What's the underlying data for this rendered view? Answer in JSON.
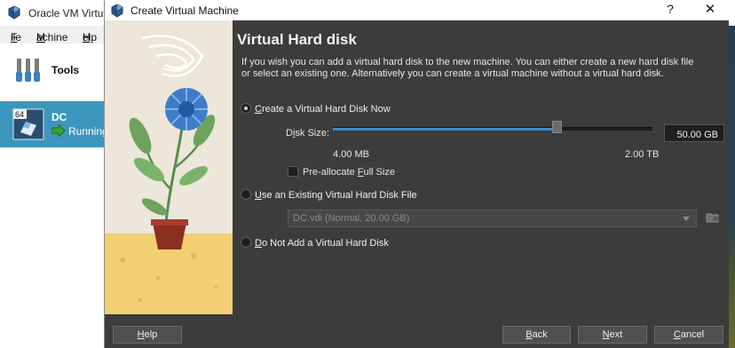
{
  "background_window": {
    "title": "Oracle VM Virtu",
    "menu": [
      {
        "label": "File",
        "accel": "F",
        "rest": "ile"
      },
      {
        "label": "Machine",
        "accel": "M",
        "rest": "achine"
      },
      {
        "label": "Help",
        "accel": "H",
        "rest": "elp"
      }
    ],
    "tools_label": "Tools",
    "vm": {
      "badge": "64",
      "name": "DC",
      "state": "Running"
    },
    "colors": {
      "selected_row": "#3d96bd",
      "running_arrow": "#3aa53a"
    }
  },
  "dialog": {
    "title": "Create Virtual Machine",
    "help_icon": "question-mark",
    "close_icon": "close-x",
    "heading": "Virtual Hard disk",
    "description": "If you wish you can add a virtual hard disk to the new machine. You can either create a new hard disk file or select an existing one. Alternatively you can create a virtual machine without a virtual hard disk.",
    "options": {
      "create_new": {
        "accel": "C",
        "rest": "reate a Virtual Hard Disk Now",
        "selected": true
      },
      "use_existing": {
        "accel": "U",
        "rest": "se an Existing Virtual Hard Disk File",
        "selected": false
      },
      "no_disk": {
        "accel": "D",
        "rest": "o Not Add a Virtual Hard Disk",
        "selected": false
      }
    },
    "disk_size": {
      "label_pre": "D",
      "label_accel": "i",
      "label_post": "sk Size:",
      "value": "50.00 GB",
      "min_label": "4.00 MB",
      "max_label": "2.00 TB",
      "slider_fraction": 0.7
    },
    "preallocate": {
      "pre": "Pre-allocate ",
      "accel": "F",
      "post": "ull Size",
      "checked": false
    },
    "existing_file": "DC.vdi (Normal, 20.00 GB)",
    "buttons": {
      "help": {
        "pre": "",
        "accel": "H",
        "post": "elp"
      },
      "back": {
        "pre": "",
        "accel": "B",
        "post": "ack"
      },
      "next": {
        "pre": "",
        "accel": "N",
        "post": "ext"
      },
      "cancel": {
        "pre": "",
        "accel": "C",
        "post": "ancel"
      }
    },
    "colors": {
      "accent": "#3b8dcf",
      "dialog_bg": "#3c3c3c"
    }
  }
}
